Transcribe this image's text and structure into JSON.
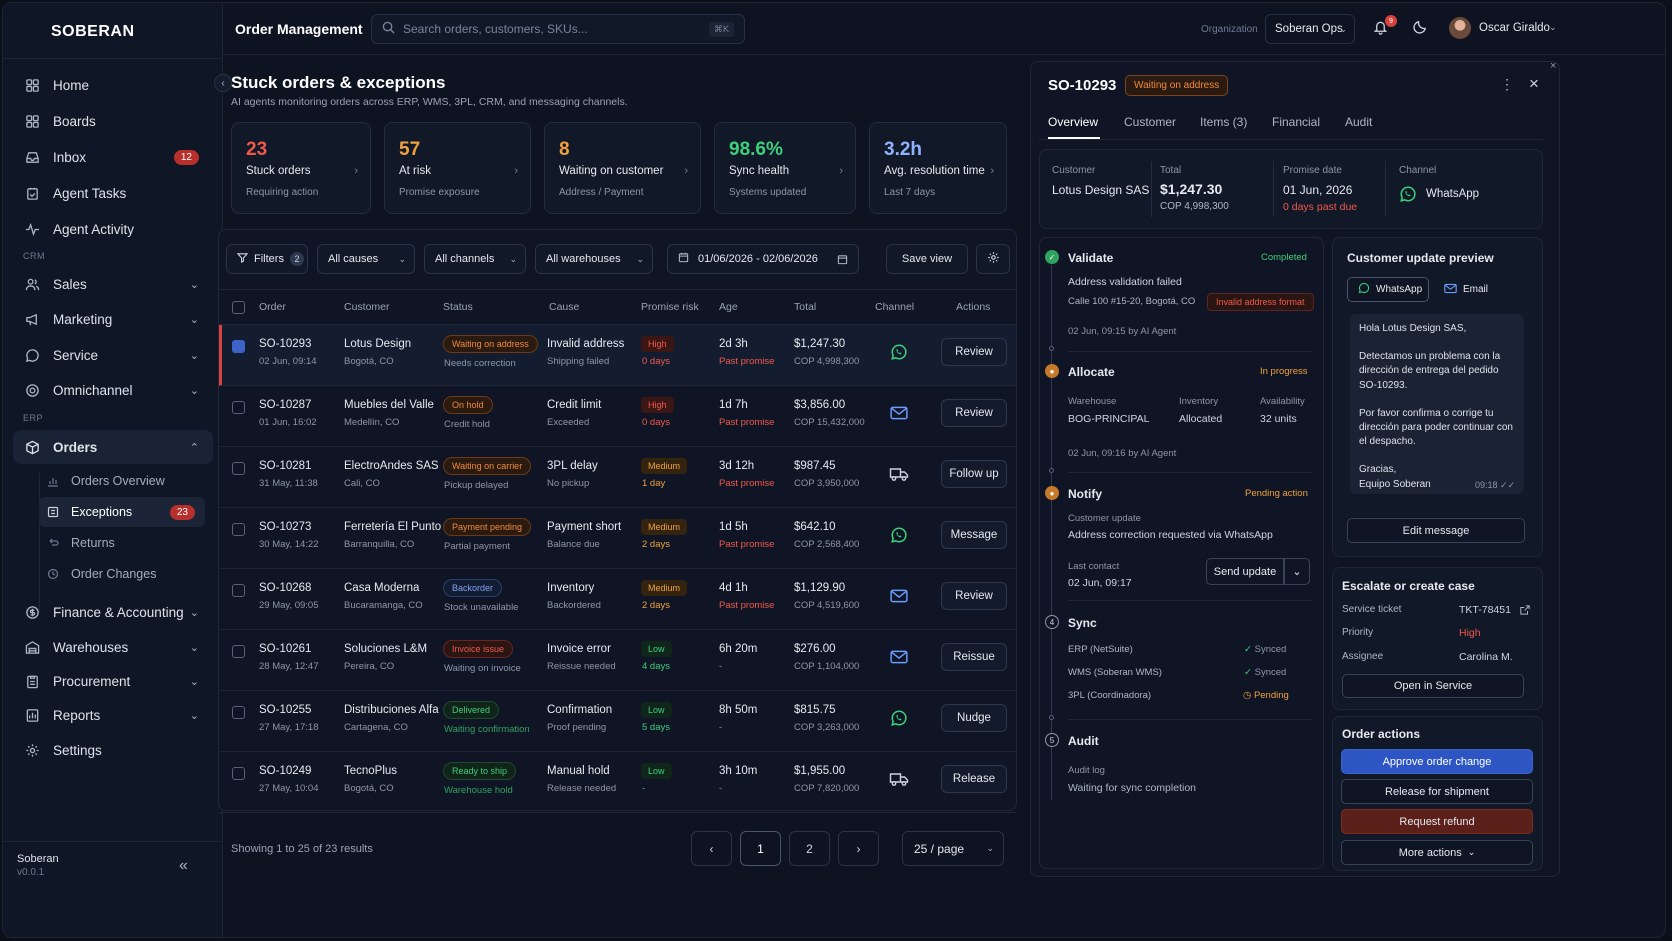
{
  "app": {
    "logo": "SOBERAN",
    "version": "v0.0.1",
    "org_footer": "Soberan"
  },
  "sidebar": {
    "items": [
      {
        "label": "Home",
        "icon": "grid-icon"
      },
      {
        "label": "Boards",
        "icon": "boards-icon"
      },
      {
        "label": "Inbox",
        "icon": "inbox-icon",
        "badge": "12"
      },
      {
        "label": "Agent Tasks",
        "icon": "tasks-icon"
      },
      {
        "label": "Agent Activity",
        "icon": "activity-icon"
      }
    ],
    "section_crm": "CRM",
    "crm": [
      {
        "label": "Sales",
        "icon": "users-icon"
      },
      {
        "label": "Marketing",
        "icon": "megaphone-icon"
      },
      {
        "label": "Service",
        "icon": "chat-icon"
      },
      {
        "label": "Omnichannel",
        "icon": "omnichannel-icon"
      }
    ],
    "section_erp": "ERP",
    "orders": {
      "label": "Orders",
      "icon": "box-icon"
    },
    "order_sub": [
      {
        "label": "Orders Overview"
      },
      {
        "label": "Exceptions",
        "badge": "23"
      },
      {
        "label": "Returns"
      },
      {
        "label": "Order Changes"
      }
    ],
    "erp": [
      {
        "label": "Finance & Accounting",
        "icon": "dollar-icon"
      },
      {
        "label": "Warehouses",
        "icon": "warehouse-icon"
      },
      {
        "label": "Procurement",
        "icon": "clipboard-icon"
      },
      {
        "label": "Reports",
        "icon": "reports-icon"
      }
    ],
    "settings": "Settings"
  },
  "topbar": {
    "title": "Order Management",
    "search_placeholder": "Search orders, customers, SKUs...",
    "search_kbd": "⌘K",
    "org_label": "Organization",
    "org_value": "Soberan Ops",
    "notif_count": "9",
    "user_name": "Oscar Giraldo"
  },
  "header": {
    "title": "Stuck orders & exceptions",
    "subtitle": "AI agents monitoring orders across ERP, WMS, 3PL, CRM, and messaging channels."
  },
  "kpis": [
    {
      "value": "23",
      "label": "Stuck orders",
      "sub": "Requiring action",
      "color": "#f0584a"
    },
    {
      "value": "57",
      "label": "At risk",
      "sub": "Promise exposure",
      "color": "#f0a13c"
    },
    {
      "value": "8",
      "label": "Waiting on customer",
      "sub": "Address / Payment",
      "color": "#f0a13c"
    },
    {
      "value": "98.6%",
      "label": "Sync health",
      "sub": "Systems updated",
      "color": "#3ecf7a"
    },
    {
      "value": "3.2h",
      "label": "Avg. resolution time",
      "sub": "Last 7 days",
      "color": "#8fb4ff"
    }
  ],
  "filters": {
    "filters_label": "Filters",
    "filters_count": "2",
    "causes": "All causes",
    "channels": "All channels",
    "warehouses": "All warehouses",
    "date_range": "01/06/2026 - 02/06/2026",
    "save_view": "Save view"
  },
  "table": {
    "headers": [
      "Order",
      "Customer",
      "Status",
      "Cause",
      "Promise risk",
      "Age",
      "Total",
      "Channel",
      "Actions"
    ],
    "rows": [
      {
        "order": "SO-10293",
        "date": "02 Jun, 09:14",
        "customer": "Lotus Design",
        "city": "Bogotá, CO",
        "status": "Waiting on address",
        "status_note": "Needs correction",
        "status_tone": "orange",
        "cause": "Invalid address",
        "cause_note": "Shipping failed",
        "risk": "High",
        "risk_days": "0 days",
        "age": "2d 3h",
        "age_note": "Past promise",
        "total": "$1,247.30",
        "total_cop": "COP 4,998,300",
        "channel": "whatsapp-icon",
        "action": "Review"
      },
      {
        "order": "SO-10287",
        "date": "01 Jun, 16:02",
        "customer": "Muebles del Valle",
        "city": "Medellín, CO",
        "status": "On hold",
        "status_note": "Credit hold",
        "status_tone": "orange",
        "cause": "Credit limit",
        "cause_note": "Exceeded",
        "risk": "High",
        "risk_days": "0 days",
        "age": "1d 7h",
        "age_note": "Past promise",
        "total": "$3,856.00",
        "total_cop": "COP 15,432,000",
        "channel": "email-icon",
        "action": "Review"
      },
      {
        "order": "SO-10281",
        "date": "31 May, 11:38",
        "customer": "ElectroAndes SAS",
        "city": "Cali, CO",
        "status": "Waiting on carrier",
        "status_note": "Pickup delayed",
        "status_tone": "orange",
        "cause": "3PL delay",
        "cause_note": "No pickup",
        "risk": "Medium",
        "risk_days": "1 day",
        "age": "3d 12h",
        "age_note": "Past promise",
        "total": "$987.45",
        "total_cop": "COP 3,950,000",
        "channel": "truck-icon",
        "action": "Follow up"
      },
      {
        "order": "SO-10273",
        "date": "30 May, 14:22",
        "customer": "Ferretería El Punto",
        "city": "Barranquilla, CO",
        "status": "Payment pending",
        "status_note": "Partial payment",
        "status_tone": "orange",
        "cause": "Payment short",
        "cause_note": "Balance due",
        "risk": "Medium",
        "risk_days": "2 days",
        "age": "1d 5h",
        "age_note": "Past promise",
        "total": "$642.10",
        "total_cop": "COP 2,568,400",
        "channel": "whatsapp-icon",
        "action": "Message"
      },
      {
        "order": "SO-10268",
        "date": "29 May, 09:05",
        "customer": "Casa Moderna",
        "city": "Bucaramanga, CO",
        "status": "Backorder",
        "status_note": "Stock unavailable",
        "status_tone": "blue",
        "cause": "Inventory",
        "cause_note": "Backordered",
        "risk": "Medium",
        "risk_days": "2 days",
        "age": "4d 1h",
        "age_note": "Past promise",
        "total": "$1,129.90",
        "total_cop": "COP 4,519,600",
        "channel": "email-icon",
        "action": "Review"
      },
      {
        "order": "SO-10261",
        "date": "28 May, 12:47",
        "customer": "Soluciones L&M",
        "city": "Pereira, CO",
        "status": "Invoice issue",
        "status_note": "Waiting on invoice",
        "status_tone": "red",
        "cause": "Invoice error",
        "cause_note": "Reissue needed",
        "risk": "Low",
        "risk_days": "4 days",
        "age": "6h 20m",
        "age_note": "-",
        "total": "$276.00",
        "total_cop": "COP 1,104,000",
        "channel": "email-icon",
        "action": "Reissue"
      },
      {
        "order": "SO-10255",
        "date": "27 May, 17:18",
        "customer": "Distribuciones Alfa",
        "city": "Cartagena, CO",
        "status": "Delivered",
        "status_note": "Waiting confirmation",
        "status_tone": "green",
        "cause": "Confirmation",
        "cause_note": "Proof pending",
        "risk": "Low",
        "risk_days": "5 days",
        "age": "8h 50m",
        "age_note": "-",
        "total": "$815.75",
        "total_cop": "COP 3,263,000",
        "channel": "whatsapp-icon",
        "action": "Nudge"
      },
      {
        "order": "SO-10249",
        "date": "27 May, 10:04",
        "customer": "TecnoPlus",
        "city": "Bogotá, CO",
        "status": "Ready to ship",
        "status_note": "Warehouse hold",
        "status_tone": "green",
        "cause": "Manual hold",
        "cause_note": "Release needed",
        "risk": "Low",
        "risk_days": "-",
        "age": "3h 10m",
        "age_note": "-",
        "total": "$1,955.00",
        "total_cop": "COP 7,820,000",
        "channel": "truck-icon",
        "action": "Release"
      }
    ]
  },
  "pagination": {
    "showing": "Showing 1 to 25 of 23 results",
    "pages": [
      "1",
      "2"
    ],
    "per_page": "25 / page"
  },
  "detail": {
    "order": "SO-10293",
    "badge": "Waiting on address",
    "tabs": [
      "Overview",
      "Customer",
      "Items (3)",
      "Financial",
      "Audit"
    ],
    "summary": {
      "customer_lbl": "Customer",
      "customer": "Lotus Design SAS",
      "total_lbl": "Total",
      "total": "$1,247.30",
      "total_cop": "COP 4,998,300",
      "promise_lbl": "Promise date",
      "promise": "01 Jun, 2026",
      "promise_note": "0 days past due",
      "channel_lbl": "Channel",
      "channel": "WhatsApp"
    },
    "timeline": {
      "validate": {
        "title": "Validate",
        "status": "Completed",
        "msg": "Address validation failed",
        "address": "Calle 100 #15-20, Bogotá, CO",
        "tag": "Invalid address format",
        "meta": "02 Jun, 09:15 by AI Agent"
      },
      "allocate": {
        "title": "Allocate",
        "status": "In progress",
        "wh_lbl": "Warehouse",
        "wh": "BOG-PRINCIPAL",
        "inv_lbl": "Inventory",
        "inv": "Allocated",
        "av_lbl": "Availability",
        "av": "32 units",
        "meta": "02 Jun, 09:16 by AI Agent"
      },
      "notify": {
        "title": "Notify",
        "status": "Pending action",
        "cu_lbl": "Customer update",
        "cu": "Address correction requested via WhatsApp",
        "lc_lbl": "Last contact",
        "lc": "02 Jun, 09:17",
        "send": "Send update"
      },
      "sync": {
        "title": "Sync",
        "step": "4",
        "rows": [
          {
            "name": "ERP (NetSuite)",
            "state": "Synced"
          },
          {
            "name": "WMS (Soberan WMS)",
            "state": "Synced"
          },
          {
            "name": "3PL (Coordinadora)",
            "state": "Pending"
          }
        ]
      },
      "audit": {
        "title": "Audit",
        "step": "5",
        "log_lbl": "Audit log",
        "log": "Waiting for sync completion"
      }
    },
    "preview": {
      "title": "Customer update preview",
      "tab_whatsapp": "WhatsApp",
      "tab_email": "Email",
      "message": [
        "Hola Lotus Design SAS,",
        "",
        "Detectamos un problema con la dirección de entrega del pedido SO-10293.",
        "",
        "Por favor confirma o corrige tu dirección para poder continuar con el despacho.",
        "",
        "Gracias,",
        "Equipo Soberan"
      ],
      "time": "09:18 ✓✓",
      "edit": "Edit message"
    },
    "escalate": {
      "title": "Escalate or create case",
      "ticket_lbl": "Service ticket",
      "ticket": "TKT-78451",
      "priority_lbl": "Priority",
      "priority": "High",
      "assignee_lbl": "Assignee",
      "assignee": "Carolina M.",
      "open": "Open in Service"
    },
    "actions": {
      "title": "Order actions",
      "approve": "Approve order change",
      "release": "Release for shipment",
      "refund": "Request refund",
      "more": "More actions"
    }
  },
  "colors": {
    "accent": "#3b63c8",
    "danger": "#d9413c",
    "warning": "#f0a13c",
    "success": "#3ecf7a",
    "whatsapp": "#3ecf7a",
    "email": "#6b9cff"
  }
}
